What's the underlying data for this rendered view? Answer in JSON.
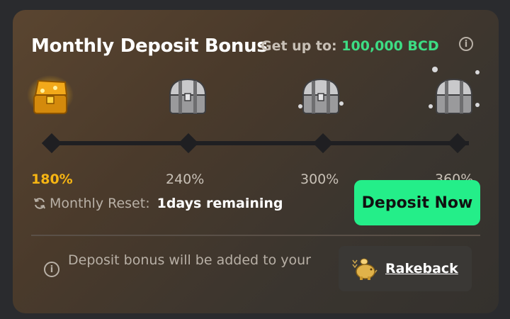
{
  "header": {
    "title": "Monthly Deposit Bonus",
    "get_up_to_label": "Get up to:",
    "get_up_to_amount": "100,000 BCD",
    "info_glyph": "i"
  },
  "tiers": [
    {
      "percent": "180%",
      "chest_icon": "gold-chest-icon",
      "active": true
    },
    {
      "percent": "240%",
      "chest_icon": "silver-chest-icon",
      "active": false
    },
    {
      "percent": "300%",
      "chest_icon": "silver-chest-icon",
      "active": false
    },
    {
      "percent": "360%",
      "chest_icon": "silver-chest-icon",
      "active": false
    }
  ],
  "reset": {
    "label": "Monthly Reset:",
    "remaining": "1days remaining"
  },
  "actions": {
    "deposit_label": "Deposit Now"
  },
  "footer": {
    "note": "Deposit bonus will be added to your",
    "rakeback_label": "Rakeback",
    "info_glyph": "i"
  },
  "colors": {
    "accent_green": "#24ee89",
    "amount_green": "#3ddc84",
    "active_gold": "#f6b513"
  }
}
